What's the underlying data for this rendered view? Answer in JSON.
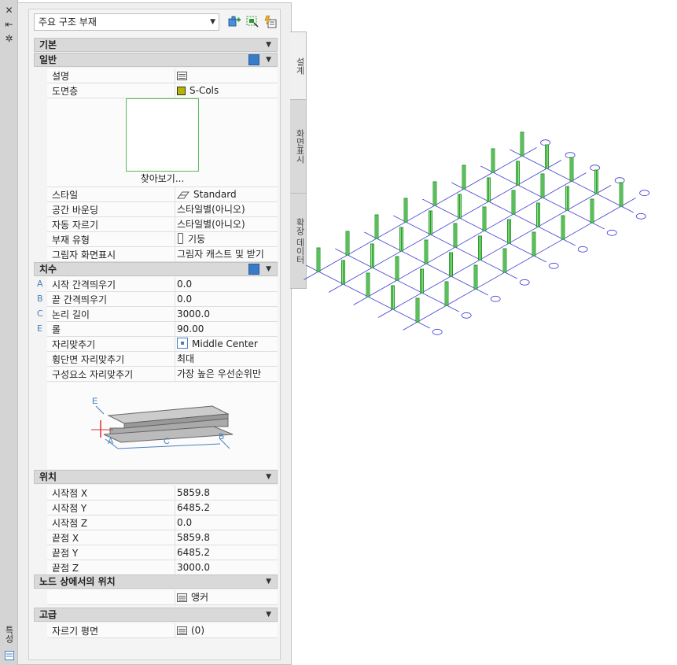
{
  "strip": {
    "title": "특성"
  },
  "tabs": [
    {
      "label": "설계"
    },
    {
      "label": "화면표시"
    },
    {
      "label": "확장 데이터"
    }
  ],
  "toolbar": {
    "style_select": "주요 구조 부재"
  },
  "sections": {
    "basic": "기본",
    "general": "일반",
    "dimensions": "치수",
    "location": "위치",
    "node_location": "노드 상에서의 위치",
    "advanced": "고급"
  },
  "general": {
    "description_label": "설명",
    "layer_label": "도면층",
    "layer_value": "S-Cols",
    "browse": "찾아보기...",
    "style_label": "스타일",
    "style_value": "Standard",
    "space_bounding_label": "공간 바운딩",
    "space_bounding_value": "스타일별(아니오)",
    "auto_trim_label": "자동 자르기",
    "auto_trim_value": "스타일별(아니오)",
    "member_type_label": "부재 유형",
    "member_type_value": "기둥",
    "shadow_label": "그림자 화면표시",
    "shadow_value": "그림자 캐스트 및 받기"
  },
  "dimensions": {
    "rows": [
      {
        "letter": "A",
        "label": "시작 간격띄우기",
        "value": "0.0"
      },
      {
        "letter": "B",
        "label": "끝 간격띄우기",
        "value": "0.0"
      },
      {
        "letter": "C",
        "label": "논리 길이",
        "value": "3000.0"
      },
      {
        "letter": "E",
        "label": "롤",
        "value": "90.00"
      }
    ],
    "justify_label": "자리맞추기",
    "justify_value": "Middle Center",
    "section_justify_label": "횡단면 자리맞추기",
    "section_justify_value": "최대",
    "component_justify_label": "구성요소 자리맞추기",
    "component_justify_value": "가장 높은 우선순위만",
    "diagram_letters": {
      "a": "A",
      "b": "B",
      "c": "C",
      "e": "E"
    }
  },
  "location": {
    "rows": [
      {
        "label": "시작점 X",
        "value": "5859.8"
      },
      {
        "label": "시작점 Y",
        "value": "6485.2"
      },
      {
        "label": "시작점 Z",
        "value": "0.0"
      },
      {
        "label": "끝점 X",
        "value": "5859.8"
      },
      {
        "label": "끝점 Y",
        "value": "6485.2"
      },
      {
        "label": "끝점 Z",
        "value": "3000.0"
      }
    ]
  },
  "node": {
    "anchor_value": "앵커"
  },
  "advanced": {
    "cut_plane_label": "자르기 평면",
    "cut_plane_value": "(0)"
  },
  "colors": {
    "grid": "#3b3bd6",
    "column": "#2a9a2a",
    "column_light": "#8fe08f"
  },
  "model": {
    "grid_rows": 5,
    "grid_cols": 8
  }
}
